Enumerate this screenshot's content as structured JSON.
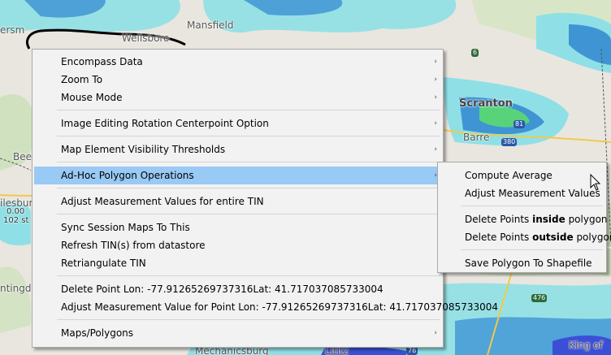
{
  "map": {
    "labels": [
      "ersm",
      "Mansfield",
      "Wellsboro",
      "Scranton",
      "Barre",
      "Bee",
      "ilesburg",
      "ntingdo",
      "Mechanicsburg",
      "Lititz",
      "King of"
    ],
    "small_labels": [
      "102 st",
      "0.00"
    ],
    "shields": [
      "380",
      "76",
      "476",
      "6",
      "81"
    ]
  },
  "context_menu": {
    "items": [
      {
        "label": "Encompass Data"
      },
      {
        "label": "Zoom To"
      },
      {
        "label": "Mouse Mode"
      },
      {
        "label": "Image Editing Rotation Centerpoint Option"
      },
      {
        "label": "Map Element Visibility Thresholds"
      },
      {
        "label": "Ad-Hoc Polygon Operations"
      },
      {
        "label": "Adjust Measurement Values for entire TIN"
      },
      {
        "label": "Sync Session Maps To This"
      },
      {
        "label": "Refresh TIN(s) from datastore"
      },
      {
        "label": "Retriangulate TIN"
      },
      {
        "label": "Delete Point Lon: -77.91265269737316Lat: 41.717037085733004"
      },
      {
        "label": "Adjust Measurement Value for Point Lon: -77.91265269737316Lat: 41.717037085733004"
      },
      {
        "label": "Maps/Polygons"
      }
    ],
    "submenu_arrow": "›"
  },
  "submenu": {
    "compute_average": "Compute Average",
    "adjust_values": "Adjust Measurement Values",
    "delete_inside_prefix": "Delete Points ",
    "delete_inside_bold": "inside",
    "delete_inside_suffix": " polygon",
    "delete_outside_prefix": "Delete Points ",
    "delete_outside_bold": "outside",
    "delete_outside_suffix": " polygon",
    "save_shapefile": "Save Polygon To Shapefile"
  },
  "colors": {
    "highlight": "#99c9f5",
    "menu_bg": "#f2f2f2",
    "rain_light": "#8ee0e6",
    "rain_mid": "#3f95d4",
    "rain_heavy": "#3b4fd6",
    "rain_green": "#58d37a"
  }
}
